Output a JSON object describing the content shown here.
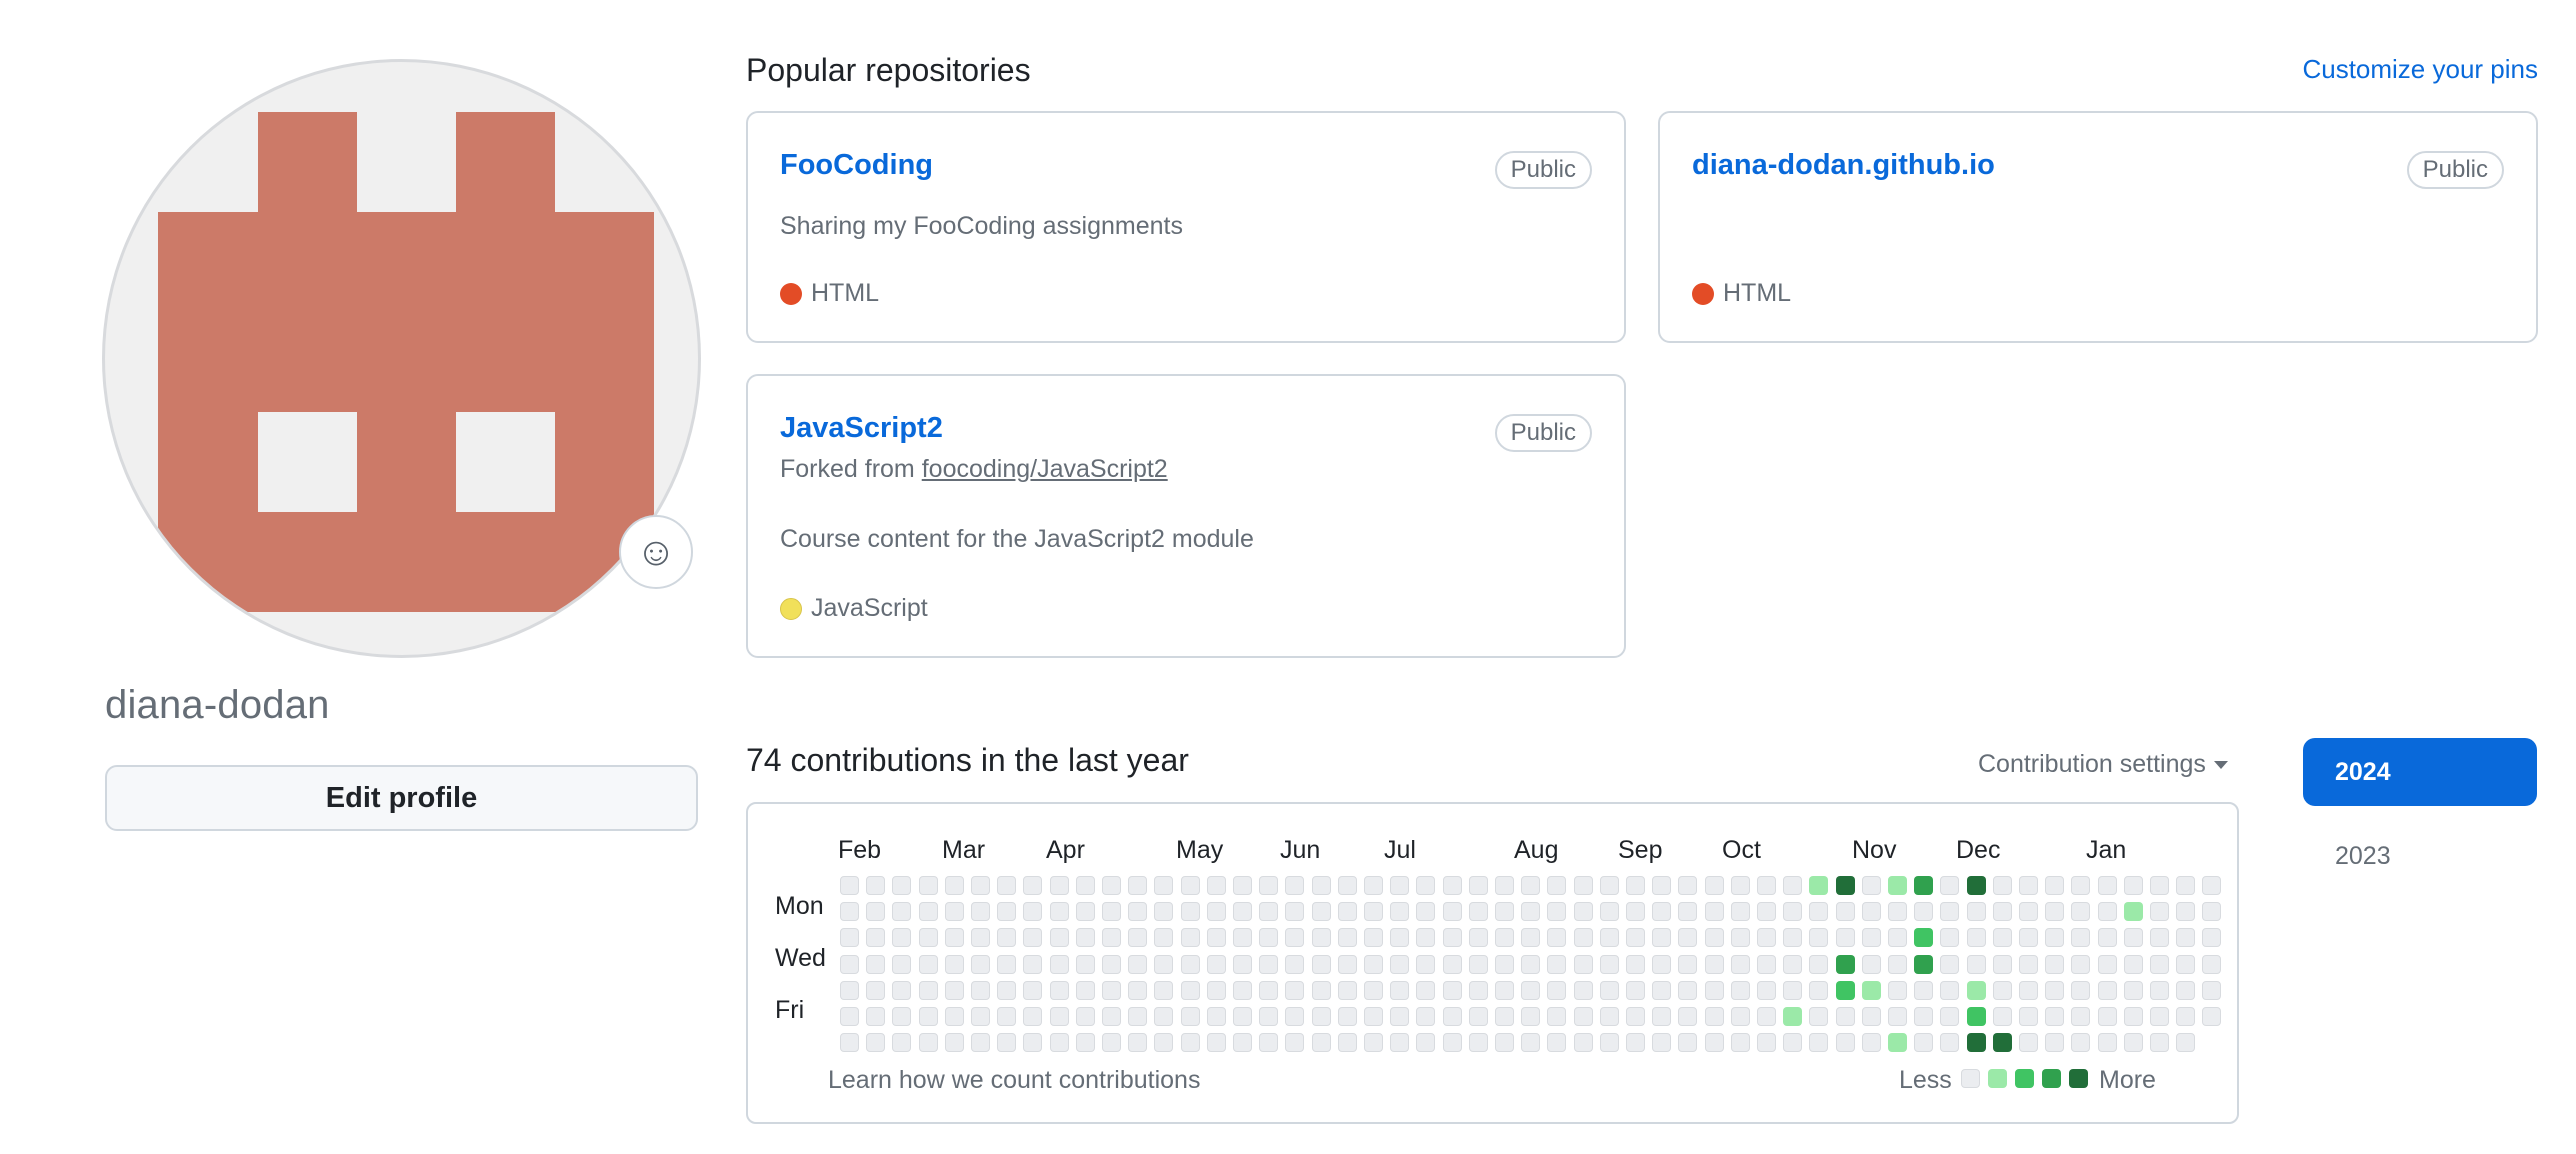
{
  "profile": {
    "username": "diana-dodan",
    "edit_label": "Edit profile",
    "status_emoji": "☺",
    "avatar_color": "#cc7a68"
  },
  "pinned": {
    "title": "Popular repositories",
    "customize_label": "Customize your pins",
    "repos": [
      {
        "name": "FooCoding",
        "visibility": "Public",
        "description": "Sharing my FooCoding assignments",
        "language": "HTML",
        "language_color": "#e34c26"
      },
      {
        "name": "diana-dodan.github.io",
        "visibility": "Public",
        "description": "",
        "language": "HTML",
        "language_color": "#e34c26"
      },
      {
        "name": "JavaScript2",
        "visibility": "Public",
        "forked_prefix": "Forked from",
        "forked_from": "foocoding/JavaScript2",
        "description": "Course content for the JavaScript2 module",
        "language": "JavaScript",
        "language_color": "#f1e05a"
      }
    ]
  },
  "contributions": {
    "title": "74 contributions in the last year",
    "settings_label": "Contribution settings",
    "months": [
      "Feb",
      "Mar",
      "Apr",
      "May",
      "Jun",
      "Jul",
      "Aug",
      "Sep",
      "Oct",
      "Nov",
      "Dec",
      "Jan"
    ],
    "day_labels": [
      "Mon",
      "Wed",
      "Fri"
    ],
    "learn_label": "Learn how we count contributions",
    "legend_less": "Less",
    "legend_more": "More",
    "level_colors": [
      "#ebedf0",
      "#9be9a8",
      "#40c463",
      "#30a14e",
      "#216e39"
    ],
    "weeks": 53,
    "last_week_days": 6,
    "active_cells": [
      [
        37,
        0,
        1
      ],
      [
        38,
        0,
        4
      ],
      [
        40,
        0,
        1
      ],
      [
        41,
        0,
        3
      ],
      [
        43,
        0,
        4
      ],
      [
        49,
        1,
        1
      ],
      [
        41,
        2,
        2
      ],
      [
        38,
        3,
        3
      ],
      [
        41,
        3,
        3
      ],
      [
        38,
        4,
        2
      ],
      [
        39,
        4,
        1
      ],
      [
        43,
        4,
        1
      ],
      [
        36,
        5,
        1
      ],
      [
        43,
        5,
        2
      ],
      [
        40,
        6,
        1
      ],
      [
        43,
        6,
        4
      ],
      [
        44,
        6,
        4
      ]
    ]
  },
  "years": [
    "2024",
    "2023"
  ],
  "colors": {
    "accent": "#0969da",
    "border": "#d0d7de",
    "muted_text": "#656d76"
  }
}
